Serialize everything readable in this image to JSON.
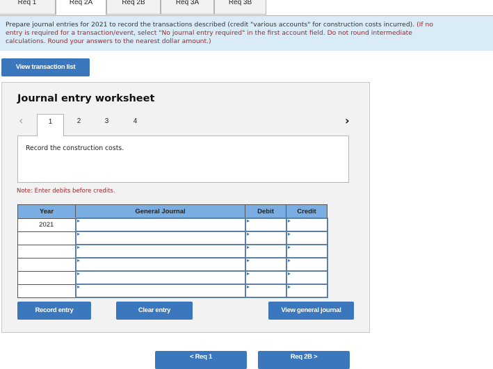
{
  "tabs": [
    {
      "label": "Req 1",
      "active": false
    },
    {
      "label": "Req 2A",
      "active": true
    },
    {
      "label": "Req 2B",
      "active": false
    },
    {
      "label": "Req 3A",
      "active": false
    },
    {
      "label": "Req 3B",
      "active": false
    }
  ],
  "instructions": {
    "main": "Prepare journal entries for 2021 to record the transactions described (credit \"various accounts\" for construction costs incurred).",
    "red_line1": " (If no",
    "red_line2": "entry is required for a transaction/event, select \"No journal entry required\" in the first account field. Do not round intermediate",
    "red_line3": "calculations. Round your answers to the nearest dollar amount.)"
  },
  "view_transaction_list_label": "View transaction list",
  "worksheet": {
    "title": "Journal entry worksheet",
    "prev_icon": "‹",
    "next_icon": "›",
    "pages": [
      "1",
      "2",
      "3",
      "4"
    ],
    "active_page": "1",
    "description": "Record the construction costs.",
    "note": "Note: Enter debits before credits.",
    "table": {
      "headers": [
        "Year",
        "General Journal",
        "Debit",
        "Credit"
      ],
      "rows": [
        {
          "year": "2021",
          "account": "",
          "debit": "",
          "credit": ""
        },
        {
          "year": "",
          "account": "",
          "debit": "",
          "credit": ""
        },
        {
          "year": "",
          "account": "",
          "debit": "",
          "credit": ""
        },
        {
          "year": "",
          "account": "",
          "debit": "",
          "credit": ""
        },
        {
          "year": "",
          "account": "",
          "debit": "",
          "credit": ""
        },
        {
          "year": "",
          "account": "",
          "debit": "",
          "credit": ""
        }
      ]
    },
    "buttons": {
      "record": "Record entry",
      "clear": "Clear entry",
      "view_journal": "View general journal"
    }
  },
  "nav_buttons": {
    "prev": "< Req 1",
    "next": "Req 2B >"
  },
  "colors": {
    "accent": "#3a77bd",
    "header_blue": "#7aaee3",
    "info_bg": "#d9ebf7",
    "note_red": "#a0262b"
  }
}
